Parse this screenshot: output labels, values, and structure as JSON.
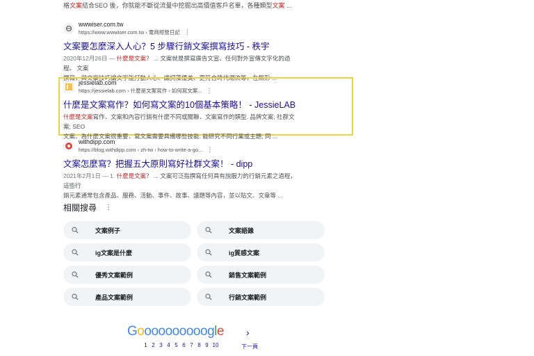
{
  "top_snippet": {
    "part1": "格",
    "em": "文案",
    "part2": "結合SEO 後，你就能不斷從流量中挖掘出高價值客戶名單，各種類型",
    "em2": "文案",
    "part3": " ..."
  },
  "results": [
    {
      "site": "wwwiser.com.tw",
      "url": "https://www.wwwiser.com.tw › 電商經營日記",
      "title": "文案要怎麼深入人心？5 步驟行銷文案撰寫技巧 - 秩宇",
      "date": "2020年12月26日 —",
      "em": "什麼是文案",
      "snippet_rest": "？ ... 文案就是撰寫廣告文宣、任何對外宣傳文字化的過程。 文案",
      "snippet_line2": "撰寫，與文案技巧讓文字能打動人心、讓詞藻優美、更符合時代潮流等，在無形 ..."
    },
    {
      "site": "jessielab.com",
      "url": "https://jessielab.com › 什麼是文案寫作 › 如何寫文案...",
      "title": "什麼是文案寫作？如何寫文案的10個基本策略！ - JessieLAB",
      "em": "什麼是文案",
      "snippet_rest": "寫作．文案和內容行銷有什麼不同或關聯．文案寫作的類型. 品牌文案; 社群文案; SEO",
      "snippet_line2": "文案．為什麼文案很重要．寫文案需要具備哪些技能. 能研究不同行業或主題; 同 ..."
    },
    {
      "site": "withdipp.com",
      "url": "https://blog.withdipp.com › zh-tw › how-to-write-a-go...",
      "title": "文案怎麼寫？把握五大原則寫好社群文案！ - dipp",
      "date": "2021年2月1日 — 1.",
      "em": "什麼是文案",
      "snippet_rest": "？ ... 文案可泛指撰寫任何具有說服力的行銷元素之過程，這些行",
      "snippet_line2": "銷元素通常包含產品、服務、活動、事件、故事、議題等內容，並以貼文、文章等 ..."
    }
  ],
  "related": {
    "heading": "相關搜尋",
    "items": [
      "文案例子",
      "文案語錄",
      "ig文案是什麼",
      "ig質感文案",
      "優秀文案範例",
      "銷售文案範例",
      "產品文案範例",
      "行銷文案範例"
    ]
  },
  "pagination": {
    "pages": [
      "1",
      "2",
      "3",
      "4",
      "5",
      "6",
      "7",
      "8",
      "9",
      "10"
    ],
    "next_label": "下一頁",
    "next_arrow": "›"
  },
  "colors": {
    "link": "#1a0dab",
    "highlight": "#f4d23f",
    "emphasis": "#c5221f"
  }
}
